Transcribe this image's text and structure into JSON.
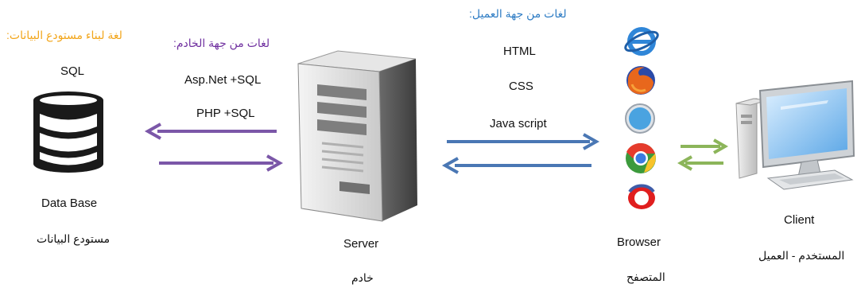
{
  "colors": {
    "db_heading": "#f2a51a",
    "server_heading": "#7030a0",
    "client_heading": "#2e7cc4",
    "purple_arrow": "#7b57a8",
    "blue_arrow": "#4a77b4",
    "green_arrow": "#8cb55a"
  },
  "database": {
    "heading": "لغة لبناء مستودع البيانات:",
    "language": "SQL",
    "icon": "database-icon",
    "label_en": "Data Base",
    "label_ar": "مستودع البيانات"
  },
  "server": {
    "heading": "لغات من جهة الخادم:",
    "languages": [
      "Asp.Net +SQL",
      "PHP +SQL"
    ],
    "icon": "server-tower-icon",
    "label_en": "Server",
    "label_ar": "خادم"
  },
  "browser": {
    "heading": "لغات من جهة العميل:",
    "languages": [
      "HTML",
      "CSS",
      "Java script"
    ],
    "icons": [
      "internet-explorer-icon",
      "firefox-icon",
      "safari-icon",
      "chrome-icon",
      "opera-icon"
    ],
    "label_en": "Browser",
    "label_ar": "المتصفح"
  },
  "client": {
    "icon": "desktop-computer-icon",
    "label_en": "Client",
    "label_ar": "المستخدم - العميل"
  }
}
